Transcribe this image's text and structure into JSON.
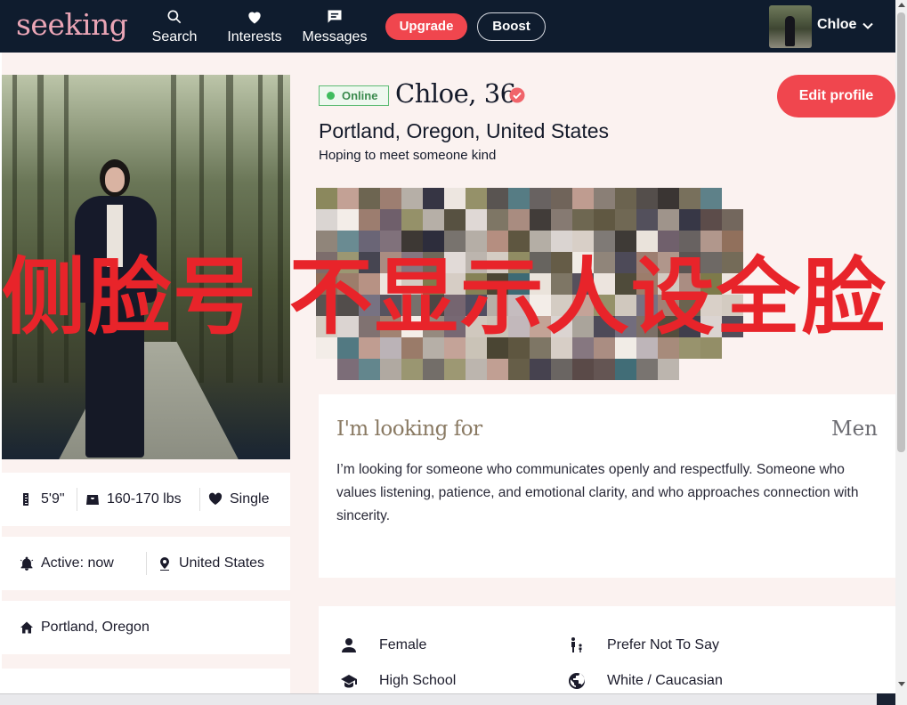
{
  "nav": {
    "logo": "seeking",
    "search_label": "Search",
    "interests_label": "Interests",
    "messages_label": "Messages",
    "upgrade_label": "Upgrade",
    "boost_label": "Boost",
    "username": "Chloe"
  },
  "profile": {
    "online_label": "Online",
    "name_age": "Chloe, 36",
    "location": "Portland, Oregon, United States",
    "headline": "Hoping to meet someone kind",
    "edit_label": "Edit profile"
  },
  "stats": {
    "height": "5'9\"",
    "weight": "160-170 lbs",
    "relationship": "Single",
    "active": "Active: now",
    "country": "United States",
    "city": "Portland, Oregon"
  },
  "looking_for": {
    "title": "I'm looking for",
    "target": "Men",
    "description": "I’m looking for someone who communicates openly and respectfully. Someone who values listening, patience, and emotional clarity, and who approaches connection with sincerity."
  },
  "details": {
    "gender": "Female",
    "children": "Prefer Not To Say",
    "education": "High School",
    "ethnicity": "White / Caucasian"
  },
  "overlay": {
    "text": "侧脸号 不显示人设全脸"
  },
  "colors": {
    "nav_bg": "#0f1c2e",
    "accent": "#f0464e",
    "logo": "#eaa5b6",
    "page_bg": "#fbf2f0",
    "online": "#3fbc5e",
    "overlay_red": "#e8242a"
  }
}
